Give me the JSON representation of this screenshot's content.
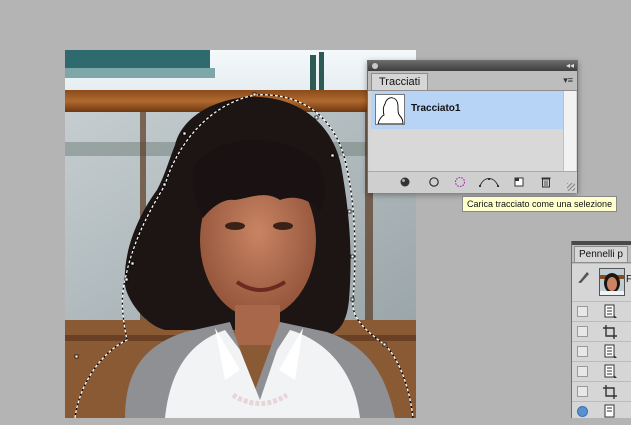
{
  "paths_panel": {
    "tab_label": "Tracciati",
    "collapse_glyph": "◂◂",
    "menu_glyph": "▾≡",
    "paths": [
      {
        "name": "Tracciato1",
        "selected": true
      }
    ],
    "toolbar_icons": [
      "fill-path-icon",
      "stroke-path-icon",
      "load-path-as-selection-icon",
      "make-work-path-icon",
      "new-path-icon",
      "delete-path-icon"
    ],
    "tooltip": "Carica tracciato come una selezione"
  },
  "history_panel": {
    "tab_label": "Pennelli p",
    "snapshot_label": "F",
    "rows": [
      "document-state",
      "crop-state",
      "document-state",
      "document-state",
      "crop-state",
      "document-state"
    ]
  },
  "colors": {
    "workspace": "#b4b4b4",
    "selection_highlight": "#b7d4f7",
    "tooltip_bg": "#ffffcc"
  }
}
